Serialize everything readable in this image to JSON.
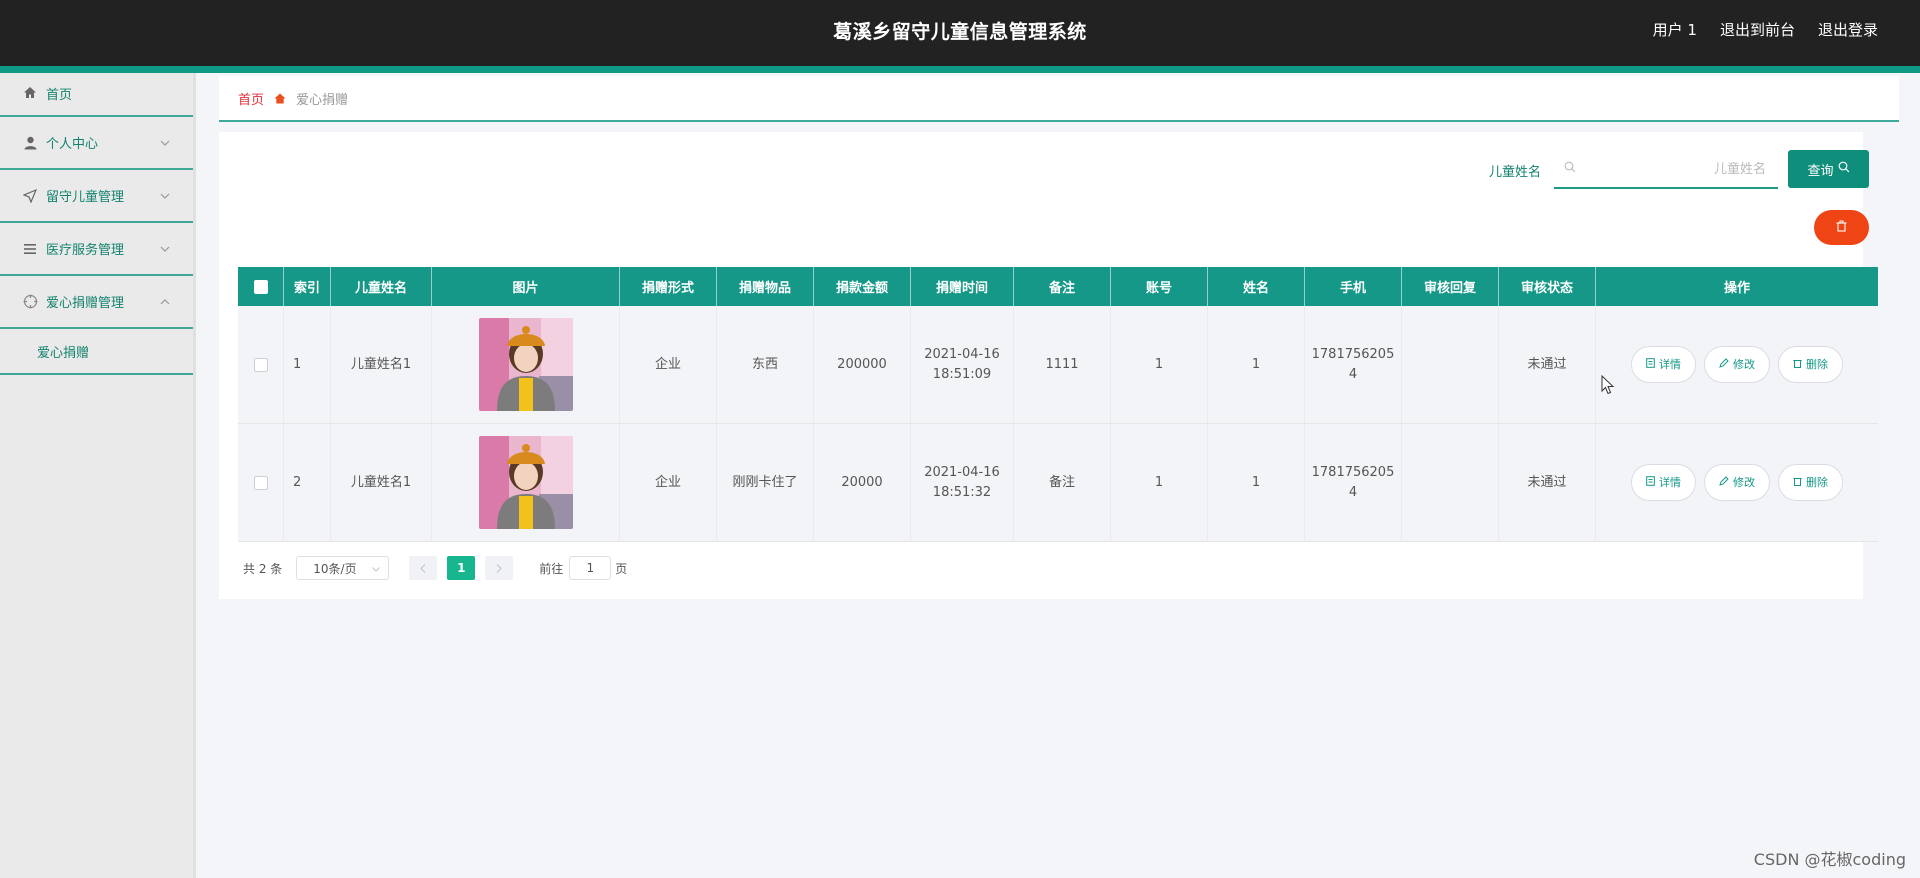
{
  "header": {
    "title": "葛溪乡留守儿童信息管理系统",
    "links": [
      "用户 1",
      "退出到前台",
      "退出登录"
    ]
  },
  "sidebar": {
    "items": [
      {
        "label": "首页",
        "icon": "home-icon"
      },
      {
        "label": "个人中心",
        "icon": "user-icon"
      },
      {
        "label": "留守儿童管理",
        "icon": "send-icon"
      },
      {
        "label": "医疗服务管理",
        "icon": "list-icon"
      },
      {
        "label": "爱心捐赠管理",
        "icon": "aim-icon"
      }
    ],
    "sub_item": "爱心捐赠"
  },
  "breadcrumb": {
    "home": "首页",
    "current": "爱心捐赠"
  },
  "search": {
    "label": "儿童姓名",
    "placeholder": "儿童姓名",
    "button": "查询"
  },
  "table": {
    "columns": [
      "索引",
      "儿童姓名",
      "图片",
      "捐赠形式",
      "捐赠物品",
      "捐款金额",
      "捐赠时间",
      "备注",
      "账号",
      "姓名",
      "手机",
      "审核回复",
      "审核状态",
      "操作"
    ],
    "rows": [
      {
        "index": "1",
        "child": "儿童姓名1",
        "form": "企业",
        "item": "东西",
        "amount": "200000",
        "date": "2021-04-16",
        "time": "18:51:09",
        "note": "1111",
        "account": "1",
        "name": "1",
        "phone_a": "1781756205",
        "phone_b": "4",
        "reply": "",
        "status": "未通过"
      },
      {
        "index": "2",
        "child": "儿童姓名1",
        "form": "企业",
        "item": "刚刚卡住了",
        "amount": "20000",
        "date": "2021-04-16",
        "time": "18:51:32",
        "note": "备注",
        "account": "1",
        "name": "1",
        "phone_a": "1781756205",
        "phone_b": "4",
        "reply": "",
        "status": "未通过"
      }
    ],
    "actions": {
      "detail": "详情",
      "edit": "修改",
      "delete": "删除"
    }
  },
  "pagination": {
    "total": "共 2 条",
    "page_size": "10条/页",
    "current": "1",
    "goto": "前往",
    "goto_value": "1",
    "unit": "页"
  },
  "watermark": "CSDN @花椒coding",
  "colors": {
    "primary": "#159887",
    "topbar": "#222222",
    "danger": "#ef4414",
    "active_page": "#18b68f",
    "breadcrumb_home": "#e0303b"
  }
}
